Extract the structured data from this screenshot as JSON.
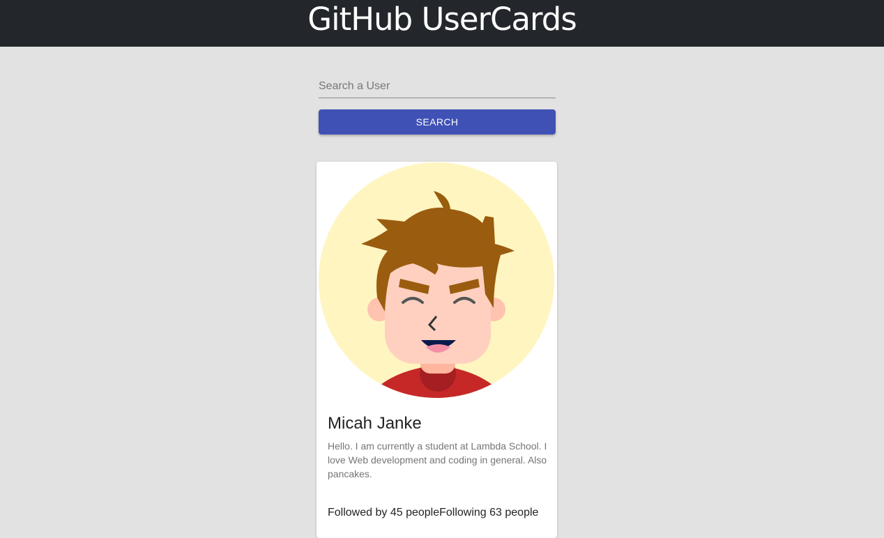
{
  "header": {
    "title": "GitHub UserCards"
  },
  "search": {
    "placeholder": "Search a User",
    "value": "",
    "button_label": "SEARCH"
  },
  "card": {
    "name": "Micah Janke",
    "bio": "Hello. I am currently a student at Lambda School. I love Web development and coding in general. Also pancakes.",
    "followers_text": "Followed by 45 people",
    "following_text": "Following 63 people"
  },
  "colors": {
    "header_bg": "#23272b",
    "page_bg": "#e2e2e2",
    "button": "#3f51b5",
    "avatar_bg": "#fff5c0",
    "hair": "#9a5c0f",
    "skin": "#ffd0c0",
    "shirt": "#c62828"
  },
  "icons": {
    "avatar": "cartoon-boy-avatar"
  }
}
